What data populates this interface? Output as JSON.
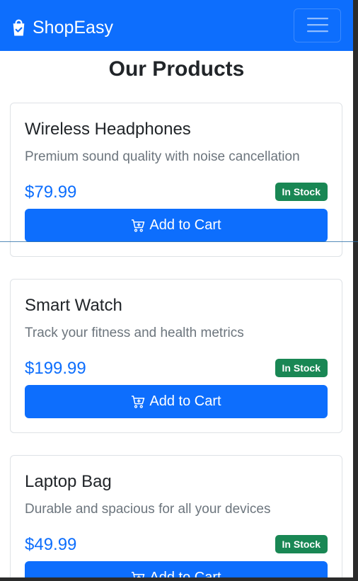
{
  "navbar": {
    "brand_icon": "shopping-bag-icon",
    "brand_name": "ShopEasy",
    "toggler_icon": "hamburger-menu-icon",
    "background_color": "#0d6efd"
  },
  "page": {
    "title": "Our Products"
  },
  "products": [
    {
      "name": "Wireless Headphones",
      "description": "Premium sound quality with noise cancellation",
      "price": "$79.99",
      "stock_status": "In Stock",
      "button_label": "Add to Cart"
    },
    {
      "name": "Smart Watch",
      "description": "Track your fitness and health metrics",
      "price": "$199.99",
      "stock_status": "In Stock",
      "button_label": "Add to Cart"
    },
    {
      "name": "Laptop Bag",
      "description": "Durable and spacious for all your devices",
      "price": "$49.99",
      "stock_status": "In Stock",
      "button_label": "Add to Cart"
    }
  ],
  "colors": {
    "primary": "#0d6efd",
    "success": "#198754",
    "text": "#212529",
    "muted": "#6c757d"
  },
  "icons": {
    "cart": "cart-plus-icon"
  }
}
